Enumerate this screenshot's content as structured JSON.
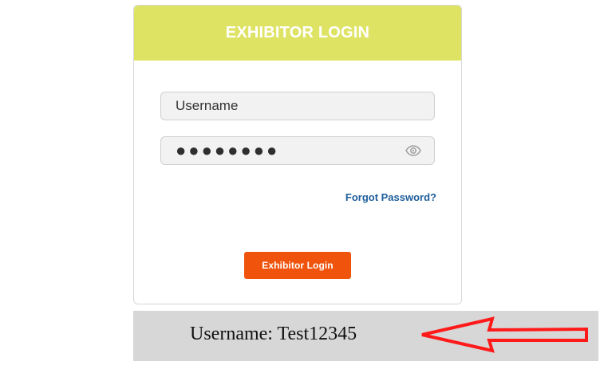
{
  "login_panel": {
    "title": "EXHIBITOR LOGIN",
    "username_field": {
      "value": "Username"
    },
    "password_field": {
      "masked_value": "●●●●●●●●",
      "show_password_icon": "eye-icon"
    },
    "forgot_password_label": "Forgot Password?",
    "submit_label": "Exhibitor Login"
  },
  "annotation": {
    "text": "Username: Test12345",
    "arrow_icon": "left-arrow-callout-icon",
    "arrow_color": "#ff1a1a"
  },
  "colors": {
    "header": "#dfe364",
    "button": "#f0530c",
    "link": "#1f5e9b",
    "note_background": "#d7d7d7"
  }
}
